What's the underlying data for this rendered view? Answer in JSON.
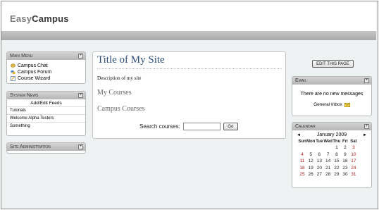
{
  "brand": {
    "easy": "Easy",
    "campus": "Campus"
  },
  "main_menu": {
    "title": "Main Menu",
    "items": [
      {
        "label": "Campus Chat",
        "icon": "chat-icon"
      },
      {
        "label": "Campus Forum",
        "icon": "forum-icon"
      },
      {
        "label": "Course Wizard",
        "icon": "wizard-icon"
      }
    ]
  },
  "system_news": {
    "title": "System News",
    "edit_link": "Add/Edit Feeds",
    "items": [
      "Tutorials",
      "Welcome Alpha Testers",
      "Something"
    ]
  },
  "site_admin": {
    "title": "Site Administration"
  },
  "main": {
    "site_title": "Title of My Site",
    "description": "Description of my site",
    "my_courses": "My Courses",
    "campus_courses": "Campus Courses",
    "search_label": "Search courses:",
    "search_value": "",
    "go_label": "Go"
  },
  "edit_page_label": "EDIT THIS PAGE",
  "email": {
    "title": "Email",
    "message": "There are no new messages",
    "inbox_label": "General Inbox"
  },
  "calendar": {
    "title": "Calendar",
    "month": "January 2009",
    "prev": "◄",
    "next": "►",
    "weekdays": [
      "Sun",
      "Mon",
      "Tue",
      "Wed",
      "Thu",
      "Fri",
      "Sat"
    ],
    "weeks": [
      [
        "",
        "",
        "",
        "",
        "1",
        "2",
        "3"
      ],
      [
        "4",
        "5",
        "6",
        "7",
        "8",
        "9",
        "10"
      ],
      [
        "11",
        "12",
        "13",
        "14",
        "15",
        "16",
        "17"
      ],
      [
        "18",
        "19",
        "20",
        "21",
        "22",
        "23",
        "24"
      ],
      [
        "25",
        "26",
        "27",
        "28",
        "29",
        "30",
        "31"
      ]
    ]
  },
  "colors": {
    "title_blue": "#2e4f7a",
    "weekend_red": "#b01818",
    "panel_header": "#c4c4c4"
  }
}
